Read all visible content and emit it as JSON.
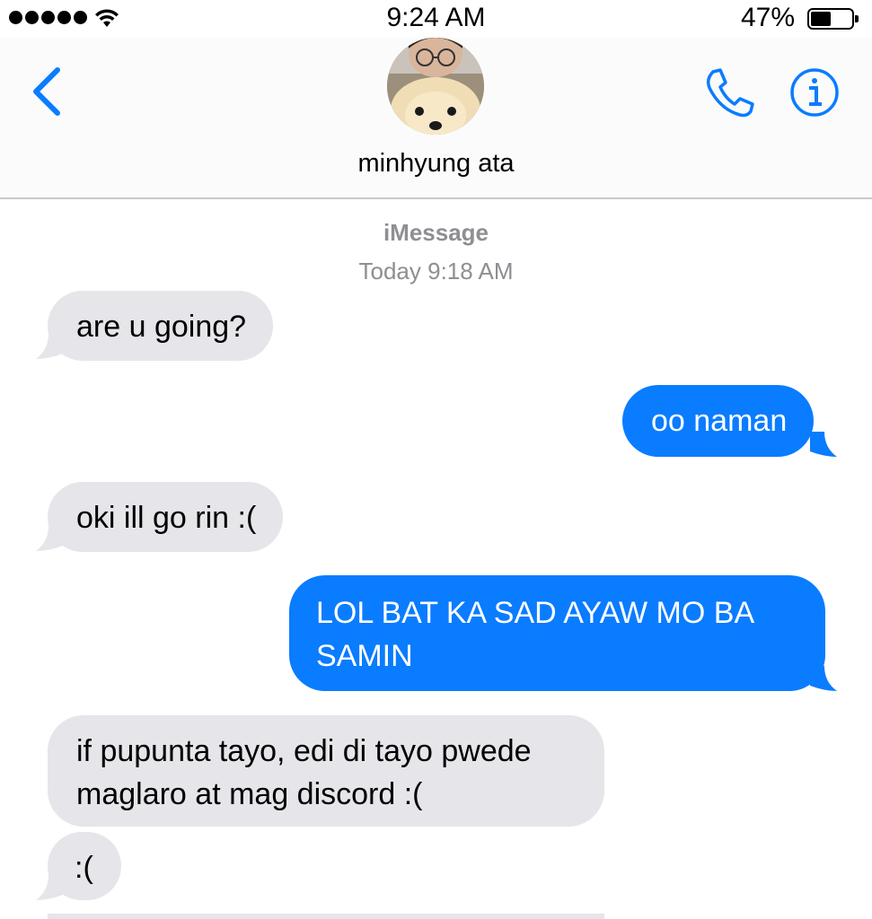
{
  "status_bar": {
    "signal_bars": 5,
    "time": "9:24 AM",
    "battery_percent": "47%",
    "battery_level": 0.47
  },
  "header": {
    "contact_name": "minhyung ata",
    "back_icon": "chevron-left-icon",
    "call_icon": "phone-icon",
    "info_icon": "info-icon"
  },
  "conversation": {
    "service": "iMessage",
    "timestamp_day": "Today",
    "timestamp_time": "9:18 AM",
    "messages": [
      {
        "direction": "incoming",
        "text": "are u going?"
      },
      {
        "direction": "outgoing",
        "text": "oo naman"
      },
      {
        "direction": "incoming",
        "text": "oki ill go rin :("
      },
      {
        "direction": "outgoing",
        "text": "LOL BAT KA SAD AYAW MO BA SAMIN"
      },
      {
        "direction": "incoming",
        "text": "if pupunta tayo, edi di tayo pwede maglaro at mag discord :("
      },
      {
        "direction": "incoming",
        "text": ":("
      }
    ]
  },
  "colors": {
    "accent": "#0a7cff",
    "incoming_bubble": "#e5e5ea",
    "meta_text": "#8e8e93"
  }
}
